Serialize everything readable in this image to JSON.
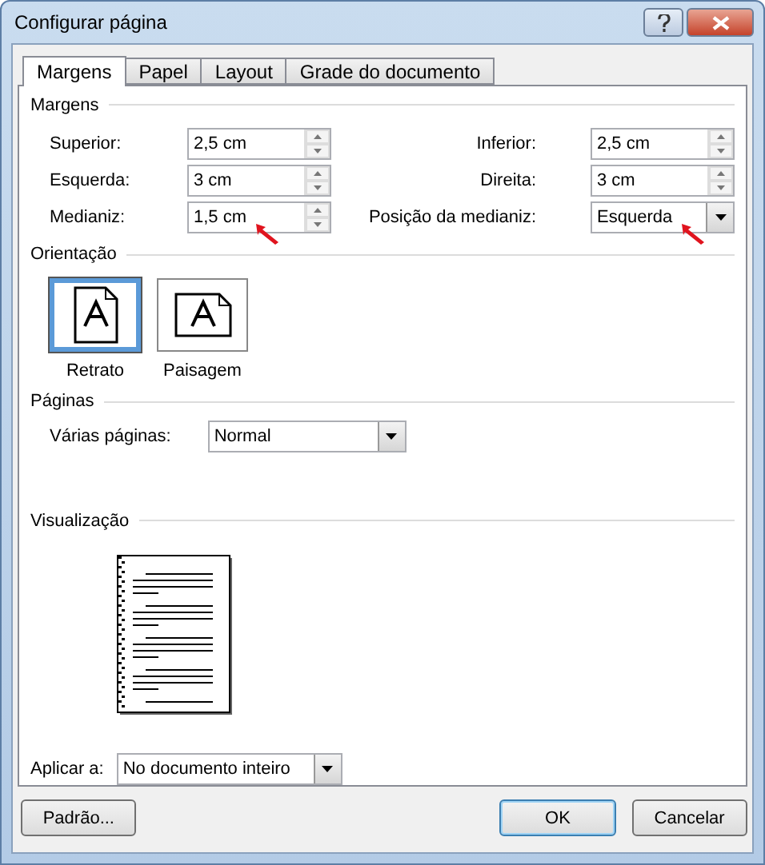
{
  "window": {
    "title": "Configurar página"
  },
  "tabs": [
    {
      "label": "Margens",
      "selected": true
    },
    {
      "label": "Papel",
      "selected": false
    },
    {
      "label": "Layout",
      "selected": false
    },
    {
      "label": "Grade do documento",
      "selected": false
    }
  ],
  "margins": {
    "title": "Margens",
    "rows": [
      {
        "left": {
          "label": "Superior:",
          "value": "2,5 cm",
          "kind": "spin",
          "marked": false
        },
        "right": {
          "label": "Inferior:",
          "value": "2,5 cm",
          "kind": "spin",
          "marked": false
        }
      },
      {
        "left": {
          "label": "Esquerda:",
          "value": "3 cm",
          "kind": "spin",
          "marked": false
        },
        "right": {
          "label": "Direita:",
          "value": "3 cm",
          "kind": "spin",
          "marked": false
        }
      },
      {
        "left": {
          "label": "Medianiz:",
          "value": "1,5 cm",
          "kind": "spin",
          "marked": true
        },
        "right": {
          "label": "Posição da medianiz:",
          "value": "Esquerda",
          "kind": "dropdown",
          "marked": true
        }
      }
    ]
  },
  "orientation": {
    "title": "Orientação",
    "options": [
      {
        "label": "Retrato",
        "kind": "portrait",
        "selected": true
      },
      {
        "label": "Paisagem",
        "kind": "landscape",
        "selected": false
      }
    ]
  },
  "pages": {
    "title": "Páginas",
    "label": "Várias páginas:",
    "value": "Normal"
  },
  "preview": {
    "title": "Visualização"
  },
  "apply_to": {
    "label": "Aplicar a:",
    "value": "No documento inteiro"
  },
  "buttons": [
    {
      "label": "Padrão...",
      "default": false
    },
    {
      "label": "OK",
      "default": true
    },
    {
      "label": "Cancelar",
      "default": false
    }
  ]
}
